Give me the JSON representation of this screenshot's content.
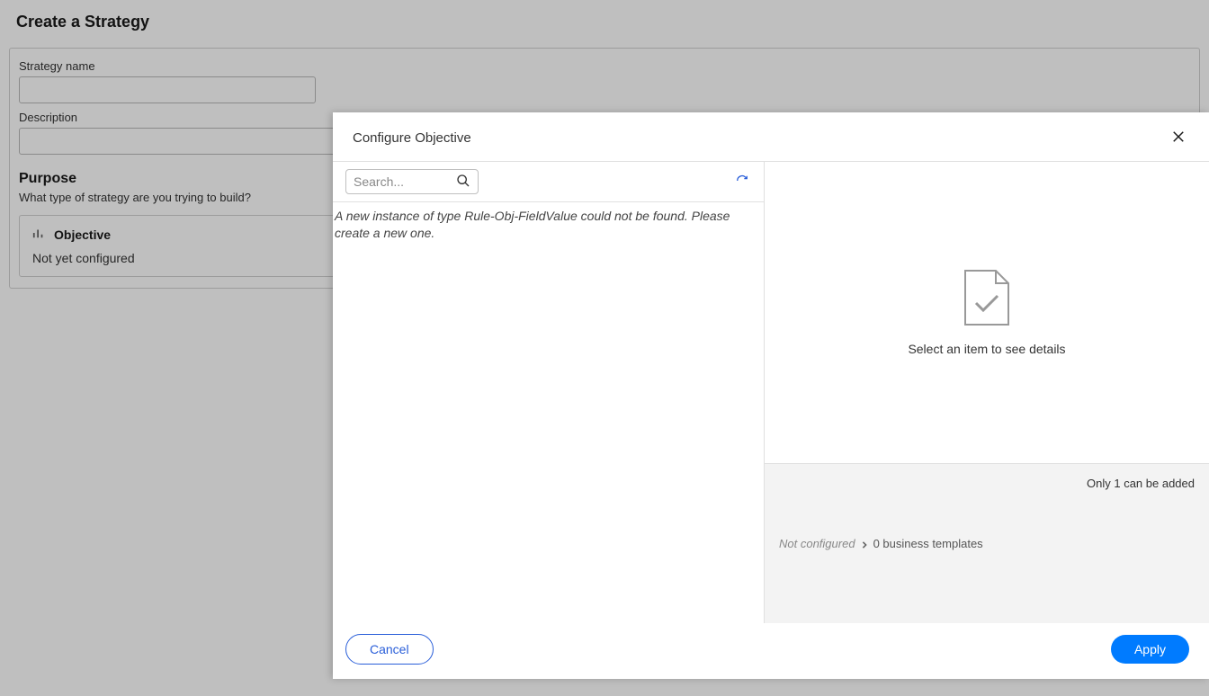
{
  "page": {
    "title": "Create a Strategy",
    "strategy_name_label": "Strategy name",
    "description_label": "Description",
    "strategy_name_value": "",
    "description_value": ""
  },
  "purpose": {
    "title": "Purpose",
    "subtitle": "What type of strategy are you trying to build?",
    "card_title": "Objective",
    "card_status": "Not yet configured"
  },
  "modal": {
    "title": "Configure Objective",
    "search_placeholder": "Search...",
    "error": "A new instance of type Rule-Obj-FieldValue could not be found. Please create a new one.",
    "detail_placeholder": "Select an item to see details",
    "not_configured": "Not configured",
    "templates_count": "0 business templates",
    "limit": "Only 1 can be added",
    "cancel_label": "Cancel",
    "apply_label": "Apply"
  }
}
